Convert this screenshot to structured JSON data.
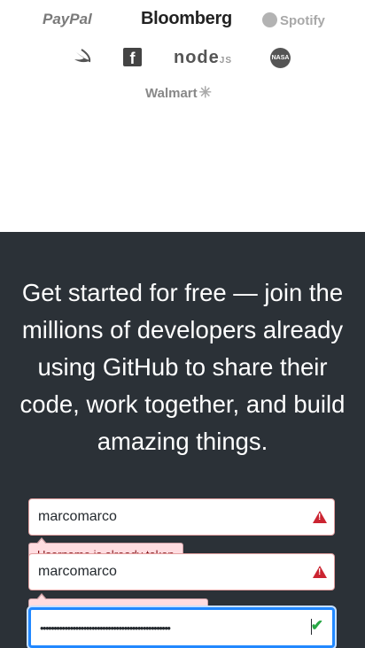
{
  "logos": {
    "paypal": "PayPal",
    "bloomberg": "Bloomberg",
    "spotify": "Spotify",
    "swift": "swift-logo",
    "facebook": "f",
    "node": "node",
    "node_suffix": "JS",
    "nasa": "NASA",
    "walmart": "Walmart",
    "walmart_spark": "✳"
  },
  "headline": "Get started for free — join the millions of developers already using GitHub to share their code, work together, and build amazing things.",
  "form": {
    "username": {
      "value": "marcomarco",
      "error": "Username is already taken"
    },
    "email": {
      "value": "marcomarco",
      "error": "Email is invalid or already taken"
    },
    "password": {
      "value": "••••••••••••••••••••••••••••••••••••••••••••••••"
    }
  },
  "colors": {
    "dark_bg": "#2b3137",
    "error_bg": "#ffdce0",
    "error_text": "#86181d",
    "success": "#28a745",
    "focus": "#2188ff"
  }
}
